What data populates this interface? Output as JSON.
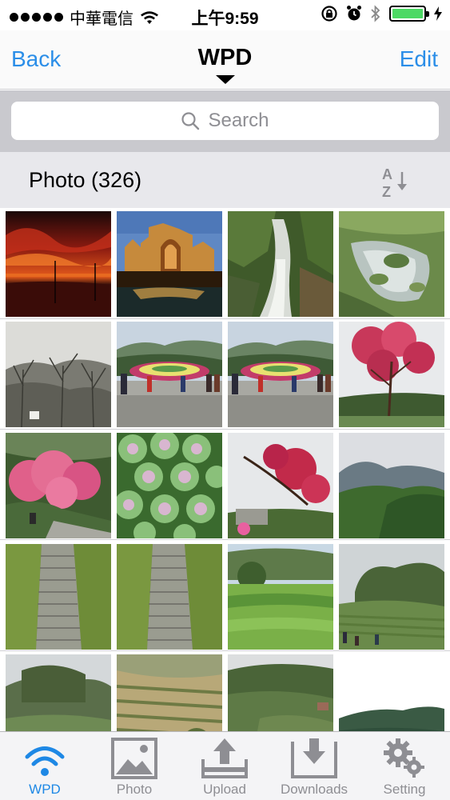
{
  "status_bar": {
    "carrier": "中華電信",
    "time": "上午9:59"
  },
  "nav": {
    "back_label": "Back",
    "title": "WPD",
    "edit_label": "Edit"
  },
  "search": {
    "placeholder": "Search"
  },
  "section": {
    "title": "Photo (326)",
    "sort_letters_top": "A",
    "sort_letters_bottom": "Z"
  },
  "photos": {
    "count_visible": 20,
    "items": [
      "sunset-sky",
      "castle-night",
      "waterfall",
      "river-rocks",
      "bare-trees",
      "flower-clock-garden",
      "flower-clock-garden",
      "pink-cherry-tree",
      "pink-cherry-blossoms",
      "ornamental-cabbage",
      "cherry-branches",
      "forest-hillside",
      "stone-stairs-moss",
      "stone-stairs-moss",
      "green-field-trees",
      "misty-terraces",
      "misty-hills",
      "terraced-farm",
      "forested-mountain",
      "distant-ridge"
    ]
  },
  "tabs": [
    {
      "label": "WPD",
      "icon": "wifi-icon",
      "active": true
    },
    {
      "label": "Photo",
      "icon": "photo-icon",
      "active": false
    },
    {
      "label": "Upload",
      "icon": "upload-icon",
      "active": false
    },
    {
      "label": "Downloads",
      "icon": "download-icon",
      "active": false
    },
    {
      "label": "Setting",
      "icon": "gear-icon",
      "active": false
    }
  ],
  "colors": {
    "accent": "#2b8ee8",
    "battery": "#4cd964"
  }
}
